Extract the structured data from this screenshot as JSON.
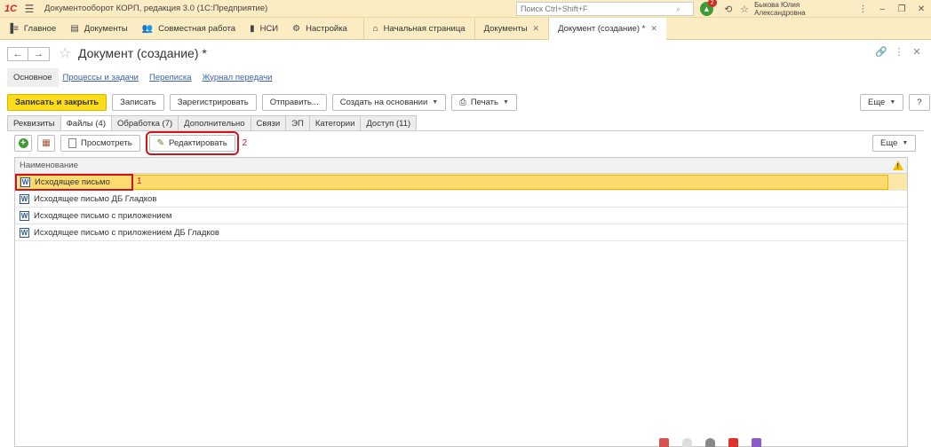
{
  "titlebar": {
    "logo": "1С",
    "app_title": "Документооборот КОРП, редакция 3.0  (1С:Предприятие)",
    "search_placeholder": "Поиск Ctrl+Shift+F",
    "notifications_count": "2",
    "user": "Быкова Юлия Александровна"
  },
  "sections": [
    {
      "label": "Главное",
      "icon": "menu-bar-icon"
    },
    {
      "label": "Документы",
      "icon": "documents-icon"
    },
    {
      "label": "Совместная работа",
      "icon": "people-icon"
    },
    {
      "label": "НСИ",
      "icon": "book-icon"
    },
    {
      "label": "Настройка",
      "icon": "gear-icon"
    }
  ],
  "open_tabs": [
    {
      "label": "Начальная страница",
      "icon": "home-icon"
    },
    {
      "label": "Документы"
    },
    {
      "label": "Документ (создание) *"
    }
  ],
  "form": {
    "title": "Документ (создание) *",
    "links": [
      "Основное",
      "Процессы и задачи",
      "Переписка",
      "Журнал передачи"
    ],
    "commands": {
      "write_close": "Записать и закрыть",
      "write": "Записать",
      "register": "Зарегистрировать",
      "send": "Отправить...",
      "create_based": "Создать на основании",
      "print": "Печать",
      "more": "Еще",
      "help": "?"
    },
    "tabs": [
      "Реквизиты",
      "Файлы (4)",
      "Обработка (7)",
      "Дополнительно",
      "Связи",
      "ЭП",
      "Категории",
      "Доступ (11)"
    ],
    "files_toolbar": {
      "view": "Просмотреть",
      "edit": "Редактировать",
      "more": "Еще",
      "annotation_edit": "2"
    },
    "table": {
      "header": "Наименование",
      "rows": [
        "Исходящее письмо",
        "Исходящее письмо ДБ Гладков",
        "Исходящее письмо с приложением",
        "Исходящее письмо с приложением ДБ Гладков"
      ],
      "annotation_row": "1"
    }
  },
  "colors": {
    "panel": "#fbecc4",
    "primary_button": "#fcdc18",
    "selection": "#fbe7a6",
    "annotation": "#d1141b",
    "link": "#3b63a6"
  }
}
